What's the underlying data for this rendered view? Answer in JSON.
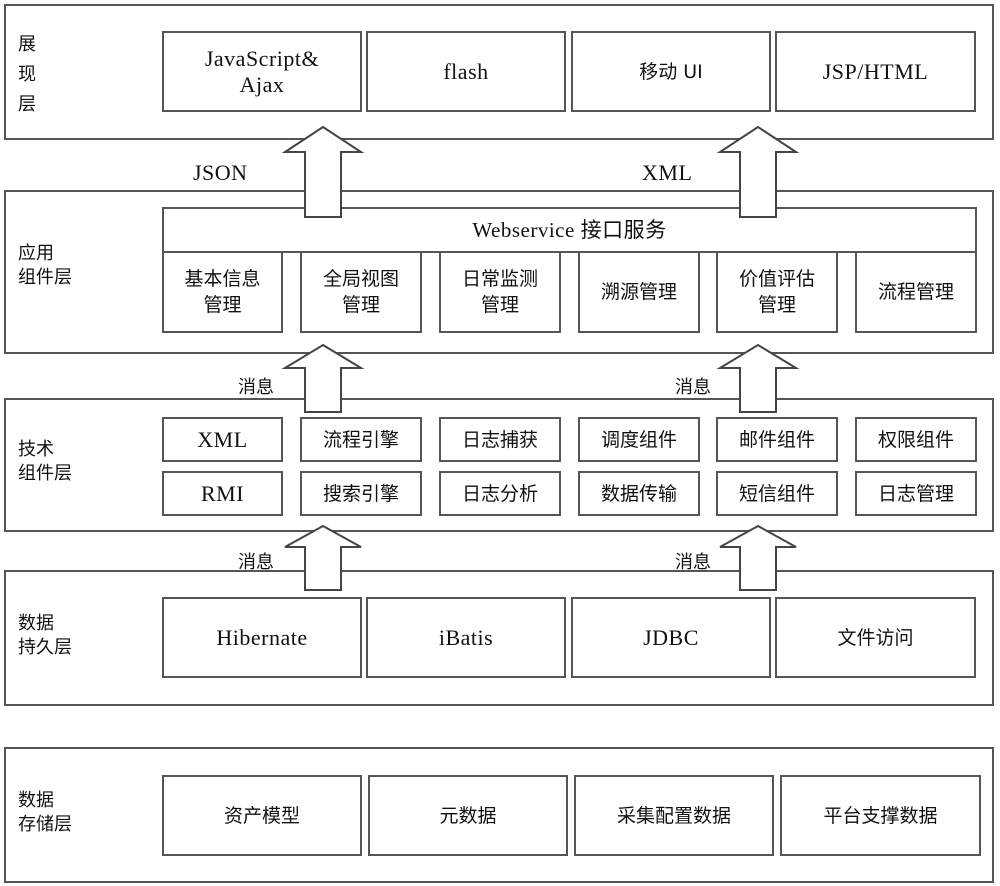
{
  "diagram": {
    "layers": [
      {
        "id": "presentation",
        "label": "展现层",
        "boxes": [
          "JavaScript&\nAjax",
          "flash",
          "移动 UI",
          "JSP/HTML"
        ]
      },
      {
        "id": "application",
        "label": "应用\n组件层",
        "service_bar": "Webservice 接口服务",
        "boxes": [
          "基本信息\n管理",
          "全局视图\n管理",
          "日常监测\n管理",
          "溯源管理",
          "价值评估\n管理",
          "流程管理"
        ]
      },
      {
        "id": "technical",
        "label": "技术\n组件层",
        "rows": [
          [
            "XML",
            "流程引擎",
            "日志捕获",
            "调度组件",
            "邮件组件",
            "权限组件"
          ],
          [
            "RMI",
            "搜索引擎",
            "日志分析",
            "数据传输",
            "短信组件",
            "日志管理"
          ]
        ]
      },
      {
        "id": "persistence",
        "label": "数据\n持久层",
        "boxes": [
          "Hibernate",
          "iBatis",
          "JDBC",
          "文件访问"
        ]
      },
      {
        "id": "storage",
        "label": "数据\n存储层",
        "boxes": [
          "资产模型",
          "元数据",
          "采集配置数据",
          "平台支撑数据"
        ]
      }
    ],
    "flows": [
      {
        "from": "application",
        "to": "presentation",
        "left_label": "JSON",
        "right_label": "XML"
      },
      {
        "from": "technical",
        "to": "application",
        "left_label": "消息",
        "right_label": "消息"
      },
      {
        "from": "persistence",
        "to": "technical",
        "left_label": "消息",
        "right_label": "消息"
      }
    ]
  }
}
